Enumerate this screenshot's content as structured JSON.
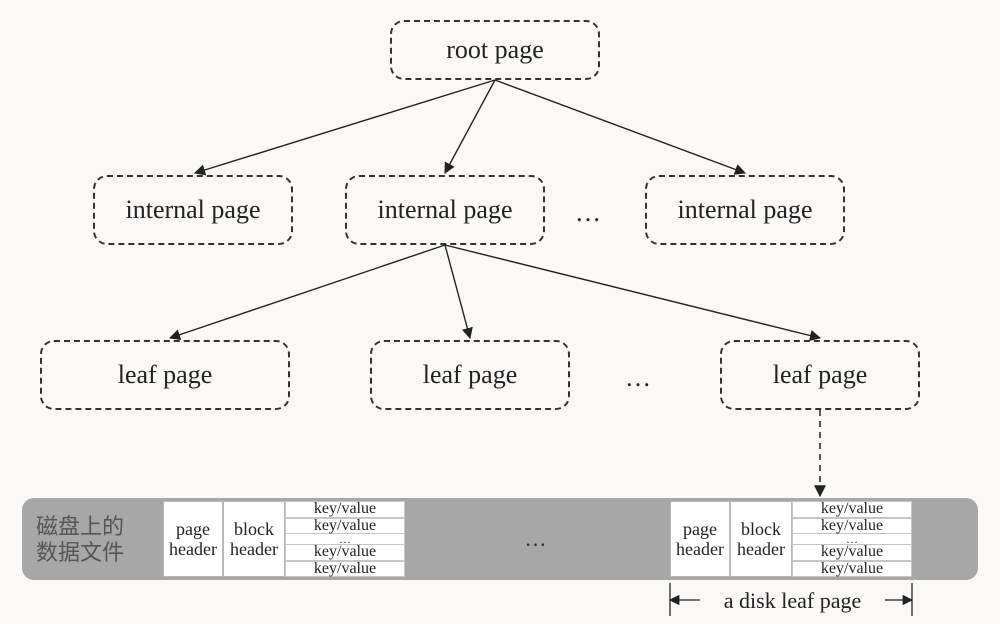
{
  "tree": {
    "root_label": "root page",
    "internal_label": "internal page",
    "leaf_label": "leaf page",
    "ellipsis": "…"
  },
  "storage": {
    "caption_line1": "磁盘上的",
    "caption_line2": "数据文件",
    "page_header": "page header",
    "block_header": "block header",
    "kv": "key/value",
    "ellipsis": "…",
    "disk_leaf_label": "a disk leaf page"
  }
}
